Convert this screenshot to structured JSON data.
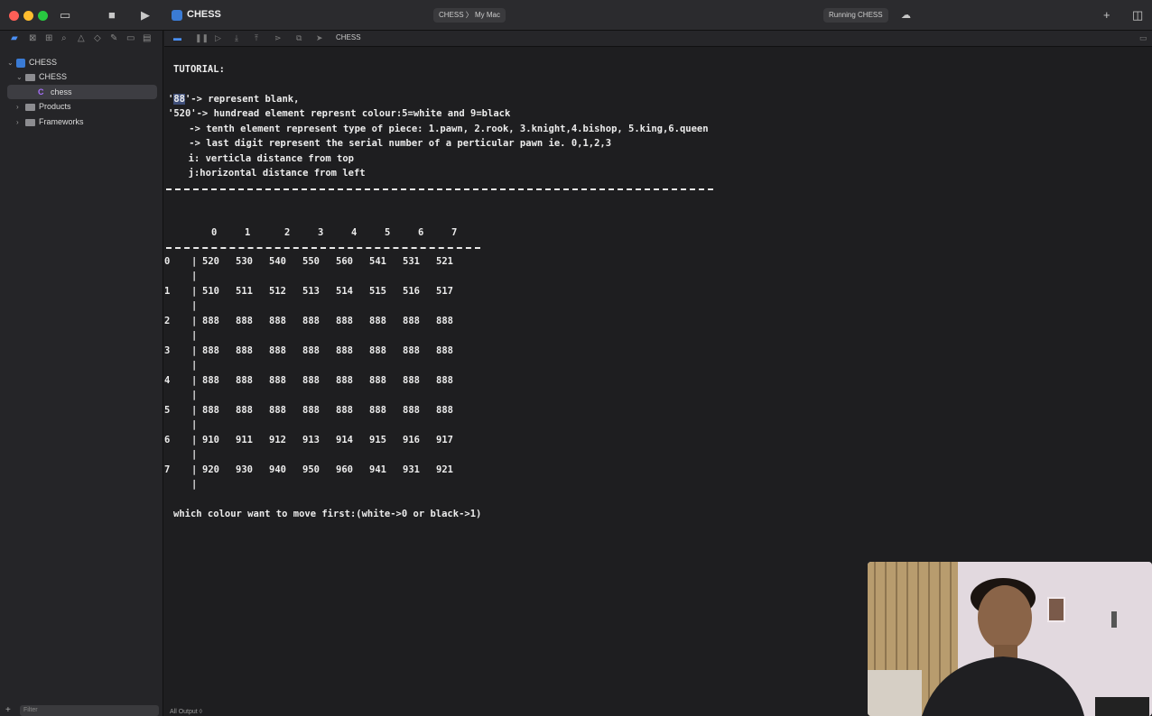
{
  "window": {
    "project_title": "CHESS",
    "scheme_label": "CHESS 〉 My Mac",
    "status_text": "Running CHESS"
  },
  "sidebar": {
    "items": [
      {
        "label": "CHESS",
        "kind": "project"
      },
      {
        "label": "CHESS",
        "kind": "folder"
      },
      {
        "label": "chess",
        "kind": "c-file"
      },
      {
        "label": "Products",
        "kind": "folder"
      },
      {
        "label": "Frameworks",
        "kind": "folder"
      }
    ],
    "filter_placeholder": "Filter"
  },
  "console_toolbar": {
    "target_label": "CHESS"
  },
  "console": {
    "tutorial_heading": "TUTORIAL:",
    "line_blank_prefix": "'",
    "line_blank_sel": "88",
    "line_blank_rest": "'-> represent blank,",
    "line_520": "'520'-> hundread element represnt colour:5=white and 9=black",
    "line_tenth": "    -> tenth element represent type of piece: 1.pawn, 2.rook, 3.knight,4.bishop, 5.king,6.queen",
    "line_last": "    -> last digit represent the serial number of a perticular pawn ie. 0,1,2,3",
    "line_i": "  i: verticla distance from top",
    "line_j": "  j:horizontal distance from left",
    "column_headers": [
      "0",
      "1",
      "2",
      "3",
      "4",
      "5",
      "6",
      "7"
    ],
    "rows": [
      {
        "index": "0",
        "cells": [
          "520",
          "530",
          "540",
          "550",
          "560",
          "541",
          "531",
          "521"
        ]
      },
      {
        "index": "1",
        "cells": [
          "510",
          "511",
          "512",
          "513",
          "514",
          "515",
          "516",
          "517"
        ]
      },
      {
        "index": "2",
        "cells": [
          "888",
          "888",
          "888",
          "888",
          "888",
          "888",
          "888",
          "888"
        ]
      },
      {
        "index": "3",
        "cells": [
          "888",
          "888",
          "888",
          "888",
          "888",
          "888",
          "888",
          "888"
        ]
      },
      {
        "index": "4",
        "cells": [
          "888",
          "888",
          "888",
          "888",
          "888",
          "888",
          "888",
          "888"
        ]
      },
      {
        "index": "5",
        "cells": [
          "888",
          "888",
          "888",
          "888",
          "888",
          "888",
          "888",
          "888"
        ]
      },
      {
        "index": "6",
        "cells": [
          "910",
          "911",
          "912",
          "913",
          "914",
          "915",
          "916",
          "917"
        ]
      },
      {
        "index": "7",
        "cells": [
          "920",
          "930",
          "940",
          "950",
          "960",
          "941",
          "931",
          "921"
        ]
      }
    ],
    "prompt": "which colour want to move first:(white->0 or black->1)",
    "footer": "All Output ◊"
  },
  "colors": {
    "accent": "#4a8ff5",
    "background": "#1e1e20",
    "sidebar": "#252528"
  }
}
